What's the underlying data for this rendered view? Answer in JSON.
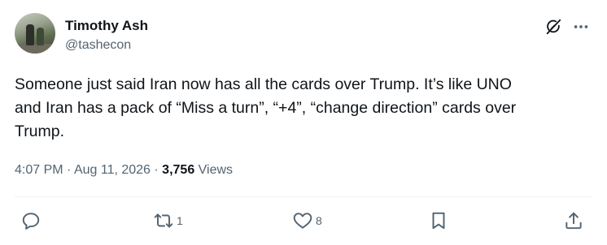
{
  "author": {
    "name": "Timothy Ash",
    "handle": "@tashecon"
  },
  "tweet": {
    "text": "Someone just said Iran now has all the cards over Trump. It’s like UNO\nand Iran has a pack of “Miss a turn”, “+4”, “change direction” cards over\nTrump.",
    "time": "4:07 PM",
    "separator": " · ",
    "date": "Aug 11, 2026",
    "views_count": "3,756",
    "views_label": " Views"
  },
  "actions": {
    "reply_count": "",
    "retweet_count": "1",
    "like_count": "8"
  },
  "colors": {
    "text": "#0f1419",
    "secondary": "#536471",
    "icon": "#536471"
  },
  "icons": {
    "grok": "grok-icon",
    "more": "more-icon",
    "reply": "reply-icon",
    "retweet": "retweet-icon",
    "like": "heart-icon",
    "bookmark": "bookmark-icon",
    "share": "share-icon"
  }
}
